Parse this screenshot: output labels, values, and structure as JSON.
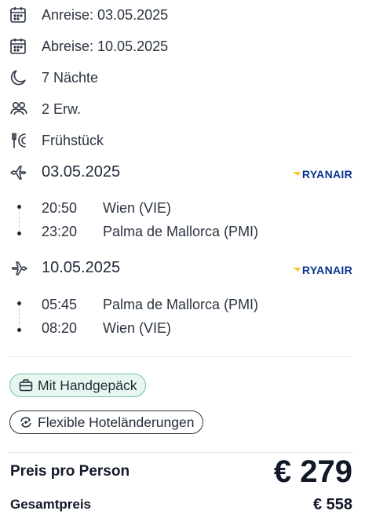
{
  "details": {
    "arrival": "Anreise: 03.05.2025",
    "departure": "Abreise: 10.05.2025",
    "nights": "7 Nächte",
    "travelers": "2 Erw.",
    "board": "Frühstück"
  },
  "outbound": {
    "date": "03.05.2025",
    "airline": "RYANAIR",
    "depart_time": "20:50",
    "depart_place": "Wien (VIE)",
    "arrive_time": "23:20",
    "arrive_place": "Palma de Mallorca (PMI)"
  },
  "inbound": {
    "date": "10.05.2025",
    "airline": "RYANAIR",
    "depart_time": "05:45",
    "depart_place": "Palma de Mallorca (PMI)",
    "arrive_time": "08:20",
    "arrive_place": "Wien (VIE)"
  },
  "features": {
    "baggage": "Mit Handgepäck",
    "flexible": "Flexible Hoteländerungen"
  },
  "price": {
    "per_person_label": "Preis pro Person",
    "per_person_value": "€ 279",
    "total_label": "Gesamtpreis",
    "total_value": "€ 558"
  },
  "colors": {
    "airline_brand": "#073590",
    "airline_harp": "#f1c933",
    "baggage_pill_bg": "#e9f6ef",
    "baggage_pill_border": "#6ec39a"
  },
  "icons": [
    "calendar-icon",
    "calendar-icon",
    "moon-icon",
    "people-icon",
    "fork-knife-icon",
    "plane-depart-icon",
    "plane-return-icon",
    "suitcase-icon",
    "flex-icon"
  ]
}
